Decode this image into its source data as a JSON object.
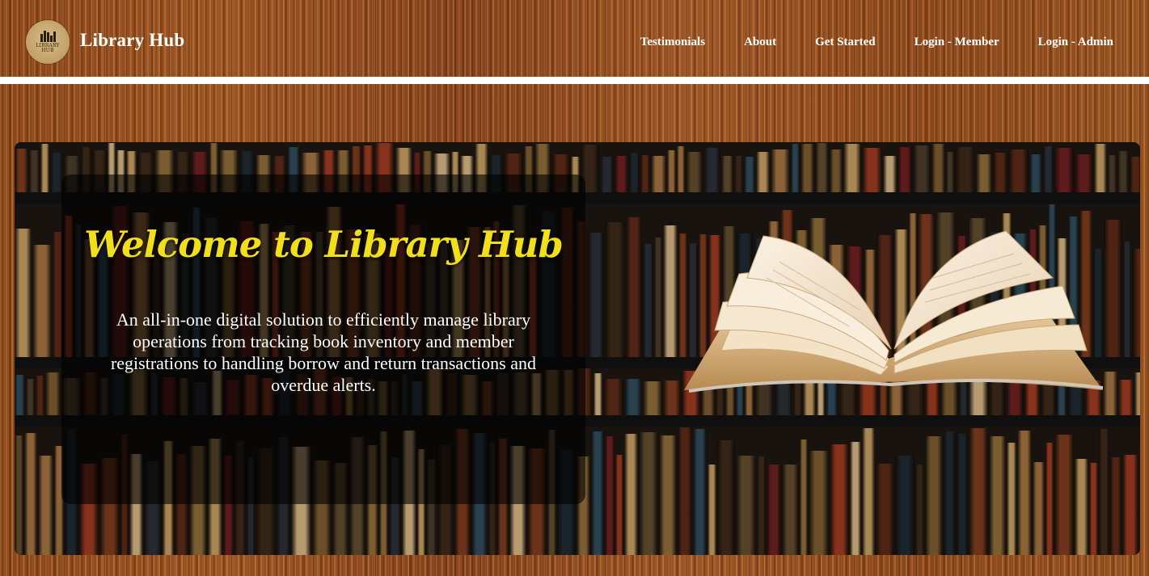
{
  "header": {
    "logo_text": "LIBRARY\nHUB",
    "brand": "Library Hub",
    "nav": [
      {
        "label": "Testimonials"
      },
      {
        "label": "About"
      },
      {
        "label": "Get Started"
      },
      {
        "label": "Login - Member"
      },
      {
        "label": "Login - Admin"
      }
    ]
  },
  "hero": {
    "title": "Welcome to Library Hub",
    "description": "An all-in-one digital solution to efficiently manage library operations from tracking book inventory and member registrations to handling borrow and return transactions and overdue alerts."
  },
  "colors": {
    "wood": "#8a4316",
    "title_yellow": "#f2df1c",
    "divider": "#ffffff"
  }
}
